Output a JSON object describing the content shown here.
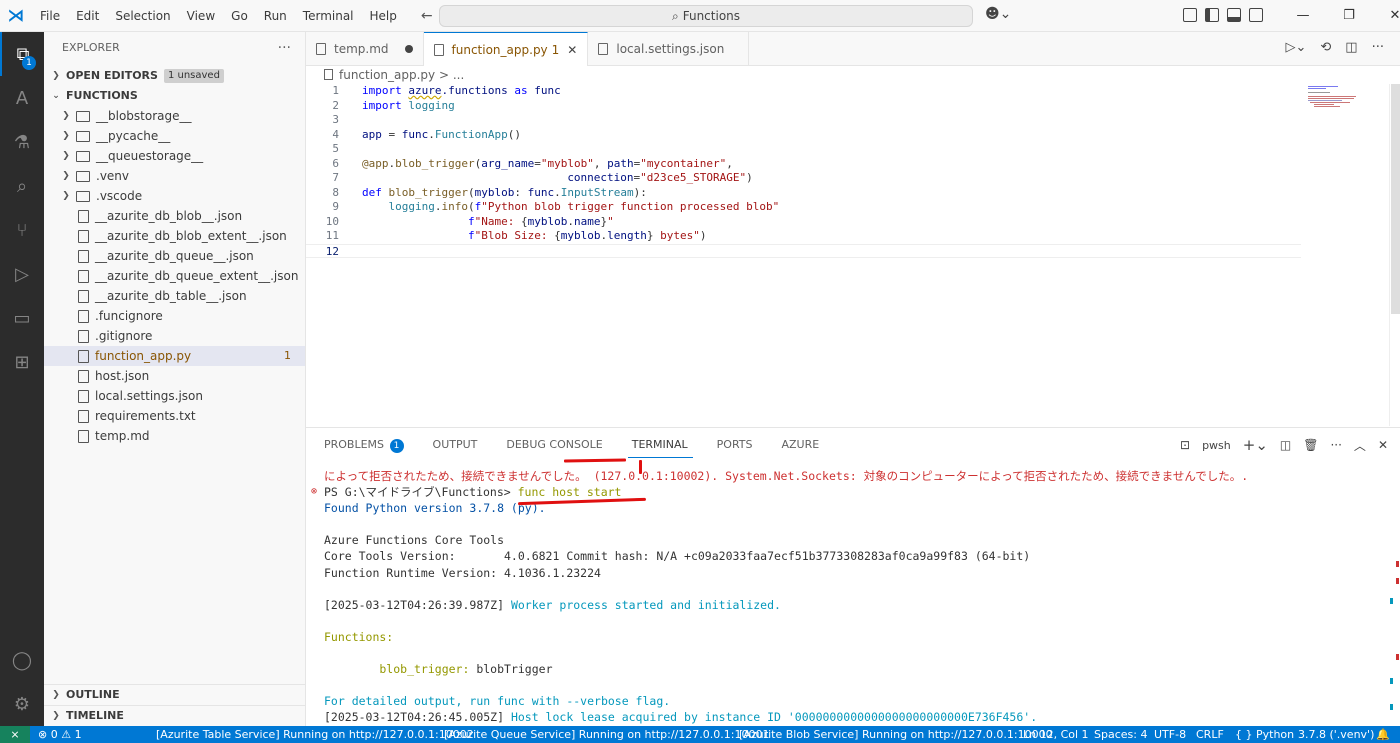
{
  "titlebar": {
    "menu": [
      "File",
      "Edit",
      "Selection",
      "View",
      "Go",
      "Run",
      "Terminal",
      "Help"
    ],
    "search": "Functions",
    "colors": {
      "accent": "#0078d4"
    }
  },
  "activity": {
    "explorer_badge": "1"
  },
  "sidebar": {
    "title": "EXPLORER",
    "open_editors": "OPEN EDITORS",
    "unsaved": "1 unsaved",
    "folder": "FUNCTIONS",
    "items": [
      {
        "label": "__blobstorage__",
        "type": "folder"
      },
      {
        "label": "__pycache__",
        "type": "folder"
      },
      {
        "label": "__queuestorage__",
        "type": "folder"
      },
      {
        "label": ".venv",
        "type": "folder"
      },
      {
        "label": ".vscode",
        "type": "folder"
      },
      {
        "label": "__azurite_db_blob__.json",
        "type": "file"
      },
      {
        "label": "__azurite_db_blob_extent__.json",
        "type": "file"
      },
      {
        "label": "__azurite_db_queue__.json",
        "type": "file"
      },
      {
        "label": "__azurite_db_queue_extent__.json",
        "type": "file"
      },
      {
        "label": "__azurite_db_table__.json",
        "type": "file"
      },
      {
        "label": ".funcignore",
        "type": "file"
      },
      {
        "label": ".gitignore",
        "type": "file"
      },
      {
        "label": "function_app.py",
        "type": "file",
        "count": "1"
      },
      {
        "label": "host.json",
        "type": "file"
      },
      {
        "label": "local.settings.json",
        "type": "file"
      },
      {
        "label": "requirements.txt",
        "type": "file"
      },
      {
        "label": "temp.md",
        "type": "file"
      }
    ],
    "outline": "OUTLINE",
    "timeline": "TIMELINE"
  },
  "tabs": [
    {
      "label": "temp.md"
    },
    {
      "label": "function_app.py",
      "num": "1"
    },
    {
      "label": "local.settings.json"
    }
  ],
  "breadcrumb": {
    "file": "function_app.py",
    "rest": " > ..."
  },
  "code": {
    "line_numbers": [
      "1",
      "2",
      "3",
      "4",
      "5",
      "6",
      "7",
      "8",
      "9",
      "10",
      "11",
      "12"
    ]
  },
  "panel": {
    "tabs": [
      "PROBLEMS",
      "OUTPUT",
      "DEBUG CONSOLE",
      "TERMINAL",
      "PORTS",
      "AZURE"
    ],
    "problems_badge": "1",
    "shell": "pwsh"
  },
  "terminal": {
    "l1": "によって拒否されたため、接続できませんでした。 (127.0.0.1:10002). System.Net.Sockets: 対象のコンピューターによって拒否されたため、接続できませんでした。.",
    "l2_prompt": "PS G:\\マイドライブ\\Functions> ",
    "l2_cmd": "func host start",
    "l3": "Found Python version 3.7.8 (py).",
    "l5": "Azure Functions Core Tools",
    "l6": "Core Tools Version:       4.0.6821 Commit hash: N/A +c09a2033faa7ecf51b3773308283af0ca9a99f83 (64-bit)",
    "l7": "Function Runtime Version: 4.1036.1.23224",
    "l9_ts": "[2025-03-12T04:26:39.987Z] ",
    "l9_msg": "Worker process started and initialized.",
    "l11": "Functions:",
    "l13_name": "        blob_trigger: ",
    "l13_type": "blobTrigger",
    "l15": "For detailed output, run func with --verbose flag.",
    "l16_ts": "[2025-03-12T04:26:45.005Z] ",
    "l16_msg": "Host lock lease acquired by instance ID '0000000000000000000000000E736F456'."
  },
  "status": {
    "errors": "⊗ 0 ⚠ 1",
    "table": "[Azurite Table Service] Running on http://127.0.0.1:10002",
    "queue": "[Azurite Queue Service] Running on http://127.0.0.1:10001",
    "blob": "[Azurite Blob Service] Running on http://127.0.0.1:10000",
    "pos": "Ln 12, Col 1",
    "spaces": "Spaces: 4",
    "enc": "UTF-8",
    "eol": "CRLF",
    "lang": "{ } Python",
    "interp": "3.7.8 ('.venv')"
  }
}
